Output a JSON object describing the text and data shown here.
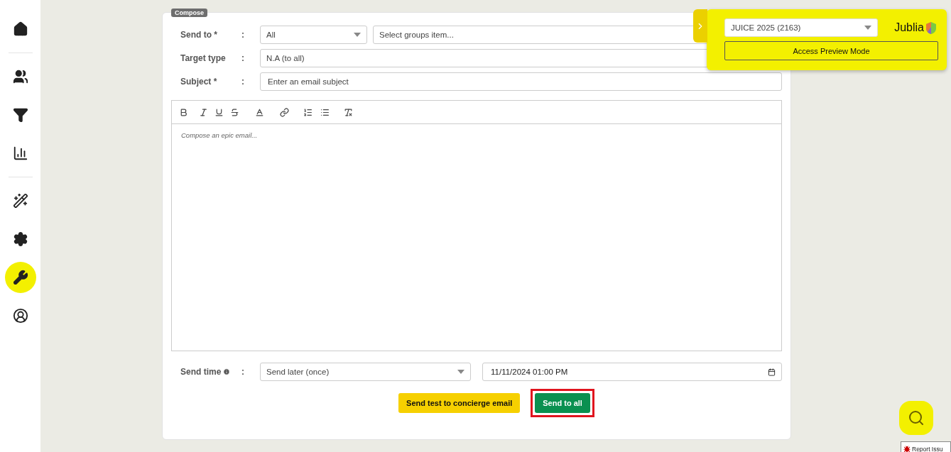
{
  "sidebar": {
    "groups": [
      [
        {
          "selected": false
        }
      ],
      [
        {
          "selected": false
        },
        {
          "selected": false
        },
        {
          "selected": false
        }
      ],
      [
        {
          "selected": false
        },
        {
          "selected": false
        },
        {
          "selected": true
        },
        {
          "selected": false
        }
      ]
    ]
  },
  "compose": {
    "legend": "Compose",
    "send_to": {
      "label": "Send to *",
      "colon": ":",
      "audience": "All",
      "groups_placeholder": "Select groups item..."
    },
    "target_type": {
      "label": "Target type",
      "colon": ":",
      "value": "N.A (to all)"
    },
    "subject": {
      "label": "Subject *",
      "colon": ":",
      "placeholder": "Enter an email subject"
    },
    "editor": {
      "placeholder": "Compose an epic email..."
    },
    "send_time": {
      "label": "Send time",
      "colon": ":",
      "mode": "Send later (once)",
      "datetime": "11/11/2024 01:00 PM"
    },
    "buttons": [
      {
        "kind": "test",
        "label": "Send test to concierge email",
        "highlighted": false
      },
      {
        "kind": "send",
        "label": "Send to all",
        "highlighted": true
      }
    ]
  },
  "event_panel": {
    "event": "JUICE 2025 (2163)",
    "logo": "Jublia",
    "preview_button": "Access Preview Mode"
  },
  "report_issue": "Report Issu"
}
